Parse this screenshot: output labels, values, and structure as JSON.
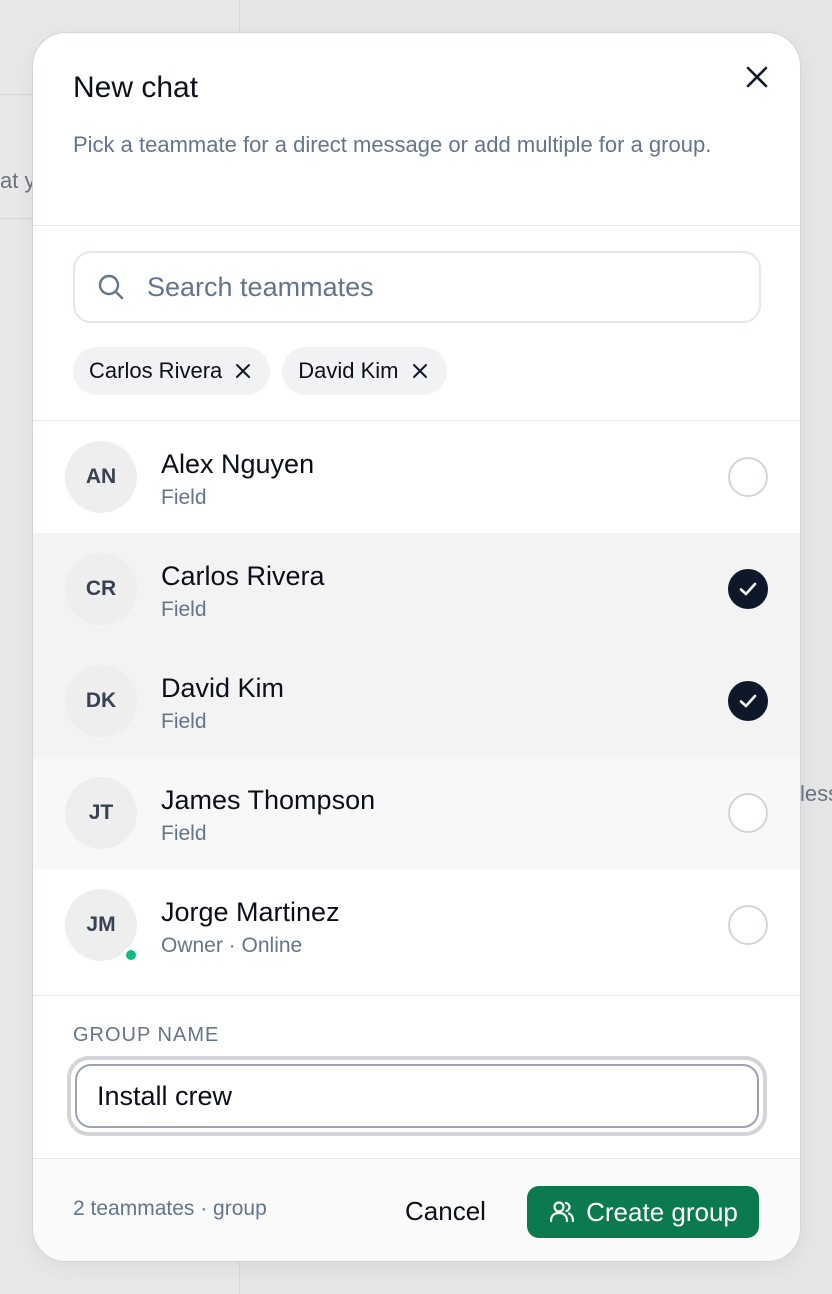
{
  "background": {
    "left_fragment": "at y",
    "right_fragment": "less"
  },
  "dialog": {
    "title": "New chat",
    "subtitle": "Pick a teammate for a direct message or add multiple for a group.",
    "close_icon": "close-icon"
  },
  "search": {
    "placeholder": "Search teammates",
    "value": "",
    "icon": "search-icon"
  },
  "chips": [
    {
      "label": "Carlos Rivera"
    },
    {
      "label": "David Kim"
    }
  ],
  "teammates": [
    {
      "initials": "AN",
      "name": "Alex Nguyen",
      "role": "Field",
      "selected": false,
      "online": false
    },
    {
      "initials": "CR",
      "name": "Carlos Rivera",
      "role": "Field",
      "selected": true,
      "online": false
    },
    {
      "initials": "DK",
      "name": "David Kim",
      "role": "Field",
      "selected": true,
      "online": false
    },
    {
      "initials": "JT",
      "name": "James Thompson",
      "role": "Field",
      "selected": false,
      "online": false
    },
    {
      "initials": "JM",
      "name": "Jorge Martinez",
      "role": "Owner · Online",
      "selected": false,
      "online": true
    }
  ],
  "group": {
    "label": "GROUP NAME",
    "value": "Install crew"
  },
  "footer": {
    "status": "2 teammates · group",
    "cancel_label": "Cancel",
    "create_label": "Create group",
    "create_icon": "users-icon",
    "accent": "#0c7a4f"
  },
  "colors": {
    "check_on": "#0f172a",
    "online_dot": "#10b981"
  }
}
